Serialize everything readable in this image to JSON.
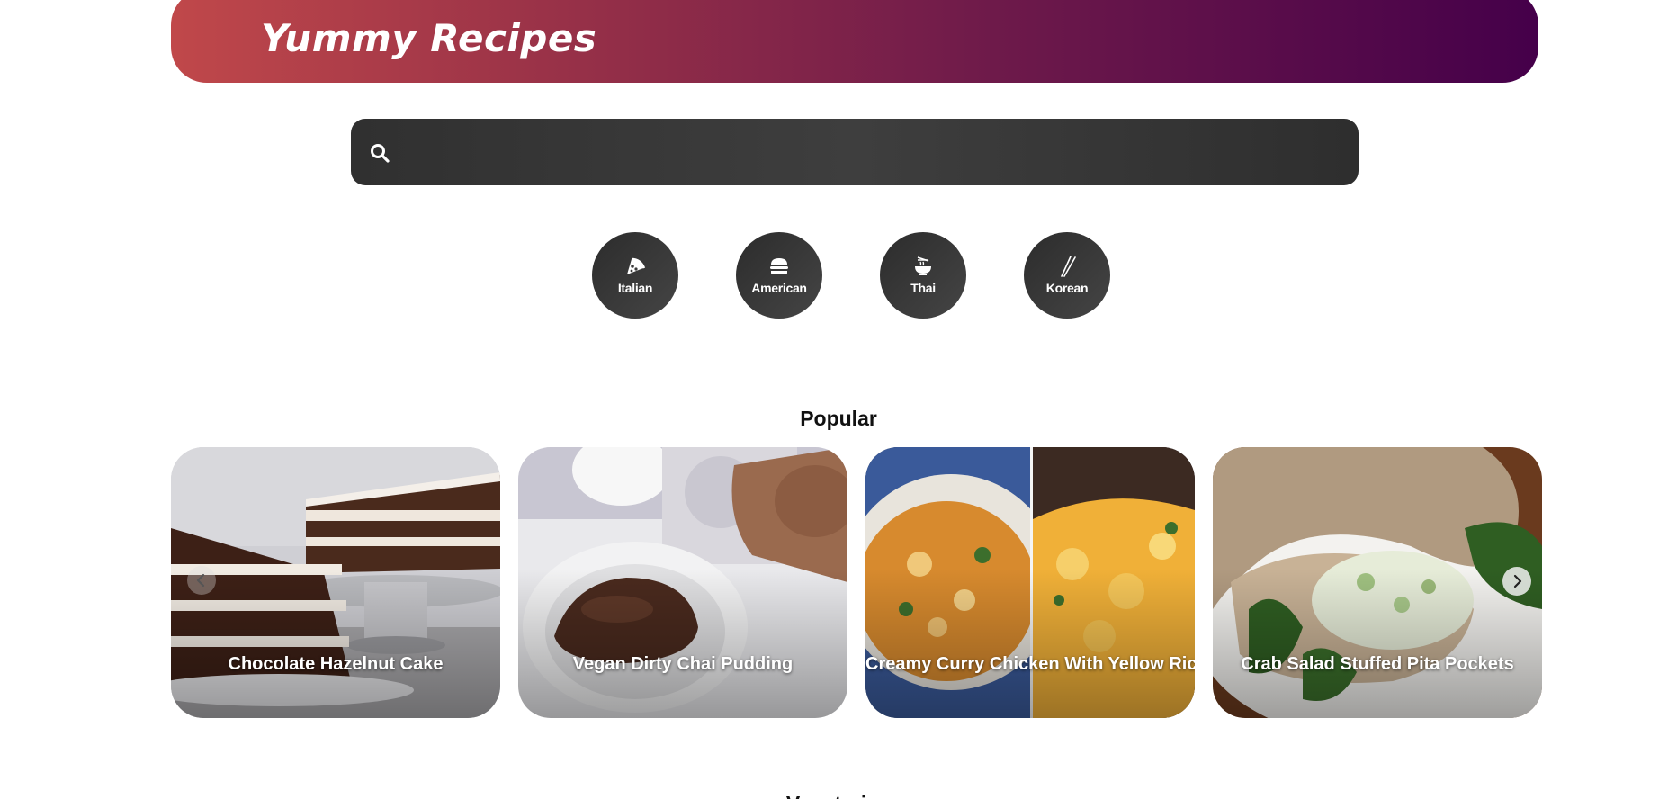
{
  "header": {
    "logo_text": "Yummy Recipes",
    "gradient_start": "#c0484a",
    "gradient_end": "#45004a"
  },
  "search": {
    "value": "",
    "placeholder": "",
    "icon": "search-icon"
  },
  "categories": [
    {
      "label": "Italian",
      "icon": "pizza-icon"
    },
    {
      "label": "American",
      "icon": "burger-icon"
    },
    {
      "label": "Thai",
      "icon": "noodle-bowl-icon"
    },
    {
      "label": "Korean",
      "icon": "chopsticks-icon"
    }
  ],
  "popular": {
    "title": "Popular",
    "cards": [
      {
        "title": "Chocolate Hazelnut Cake"
      },
      {
        "title": "Vegan Dirty Chai Pudding"
      },
      {
        "title": "Creamy Curry Chicken With Yellow Rice"
      },
      {
        "title": "Crab Salad Stuffed Pita Pockets"
      }
    ],
    "prev_icon": "chevron-left-icon",
    "next_icon": "chevron-right-icon"
  },
  "next_section": {
    "title": "Vegetarian"
  }
}
